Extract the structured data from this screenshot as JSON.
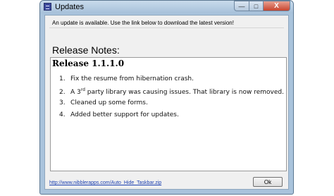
{
  "window": {
    "title": "Updates",
    "controls": {
      "minimize": "—",
      "maximize": "□",
      "close": "X"
    }
  },
  "intro_text": "An update is available.  Use the link below to download the latest version!",
  "notes_heading": "Release Notes:",
  "release": {
    "title": "Release 1.1.1.0",
    "items": [
      {
        "num": "1.",
        "text": "Fix the resume from hibernation crash."
      },
      {
        "num": "2.",
        "pre": "A 3",
        "sup": "rd",
        "post": " party library was causing issues.  That library is now removed."
      },
      {
        "num": "3.",
        "text": "Cleaned up some forms."
      },
      {
        "num": "4.",
        "text": "Added better support for updates."
      }
    ]
  },
  "download_link": "http://www.nibblerapps.com/Auto_Hide_Taskbar.zip",
  "ok_button": "Ok"
}
